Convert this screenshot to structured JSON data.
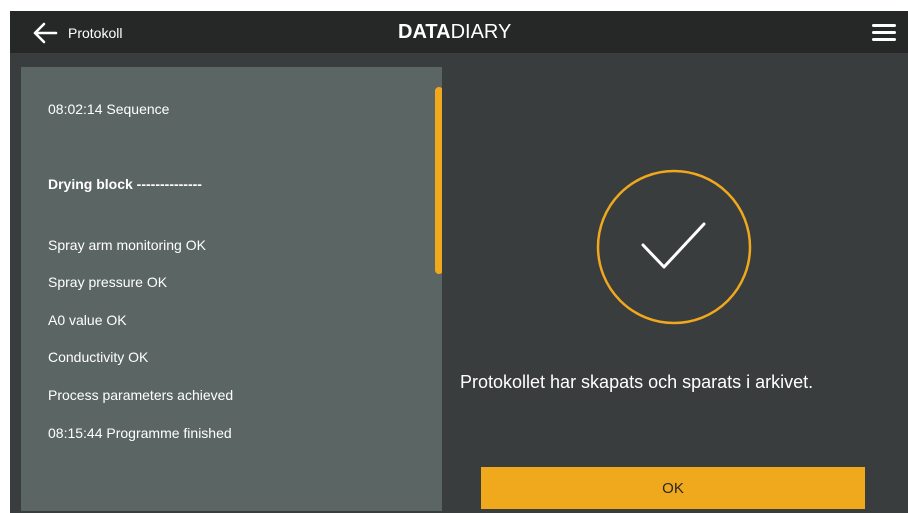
{
  "header": {
    "back_label": "Protokoll",
    "brand_bold": "DATA",
    "brand_light": "DIARY",
    "back_icon": "arrow-left-icon",
    "menu_icon": "hamburger-menu-icon"
  },
  "log": {
    "lines": [
      {
        "text": "08:02:14 Sequence",
        "bold": false
      },
      {
        "text": "Drying block --------------",
        "bold": true
      },
      {
        "text": "Spray arm monitoring OK",
        "bold": false
      },
      {
        "text": "Spray pressure OK",
        "bold": false
      },
      {
        "text": "A0 value OK",
        "bold": false
      },
      {
        "text": "Conductivity OK",
        "bold": false
      },
      {
        "text": "Process parameters achieved",
        "bold": false
      },
      {
        "text": "08:15:44 Programme finished",
        "bold": false
      }
    ]
  },
  "result": {
    "icon": "checkmark-circle-icon",
    "message": "Protokollet har skapats och sparats i arkivet.",
    "ok_label": "OK"
  },
  "colors": {
    "accent": "#f0a81d",
    "header_bg": "#262827",
    "panel_bg": "#5b6564",
    "page_bg": "#3a3d3d"
  }
}
